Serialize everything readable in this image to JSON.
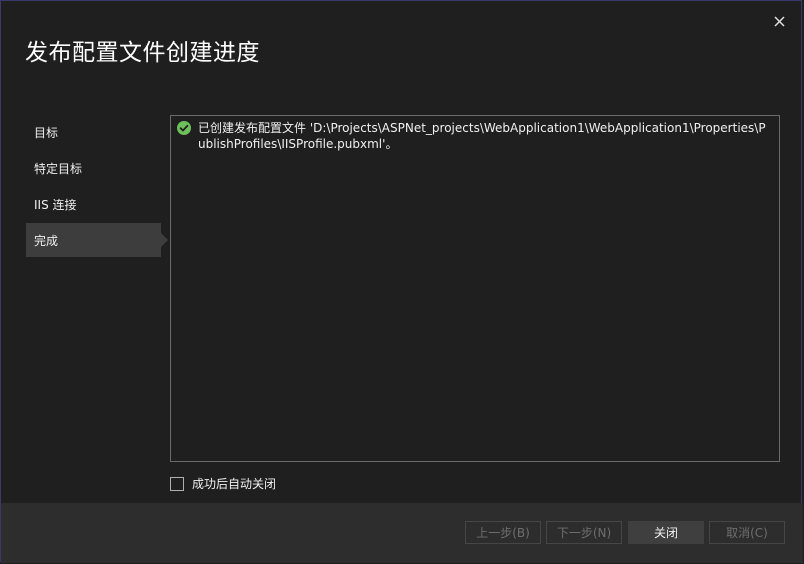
{
  "window": {
    "title": "发布配置文件创建进度",
    "close_glyph": "✕"
  },
  "nav": {
    "items": [
      {
        "label": "目标",
        "active": false
      },
      {
        "label": "特定目标",
        "active": false
      },
      {
        "label": "IIS 连接",
        "active": false
      },
      {
        "label": "完成",
        "active": true
      }
    ]
  },
  "log": {
    "entries": [
      {
        "status": "success",
        "icon": "success-check-icon",
        "text": "已创建发布配置文件 'D:\\Projects\\ASPNet_projects\\WebApplication1\\WebApplication1\\Properties\\PublishProfiles\\IISProfile.pubxml'。"
      }
    ]
  },
  "options": {
    "close_on_success_label": "成功后自动关闭",
    "close_on_success_checked": false
  },
  "footer": {
    "prev_label": "上一步(B)",
    "next_label": "下一步(N)",
    "close_label": "关闭",
    "cancel_label": "取消(C)"
  },
  "colors": {
    "background": "#1f1f1f",
    "footer": "#2d2d2d",
    "active_nav": "#3d3d3d",
    "success": "#6ec05a",
    "border": "#3a3a6a"
  }
}
